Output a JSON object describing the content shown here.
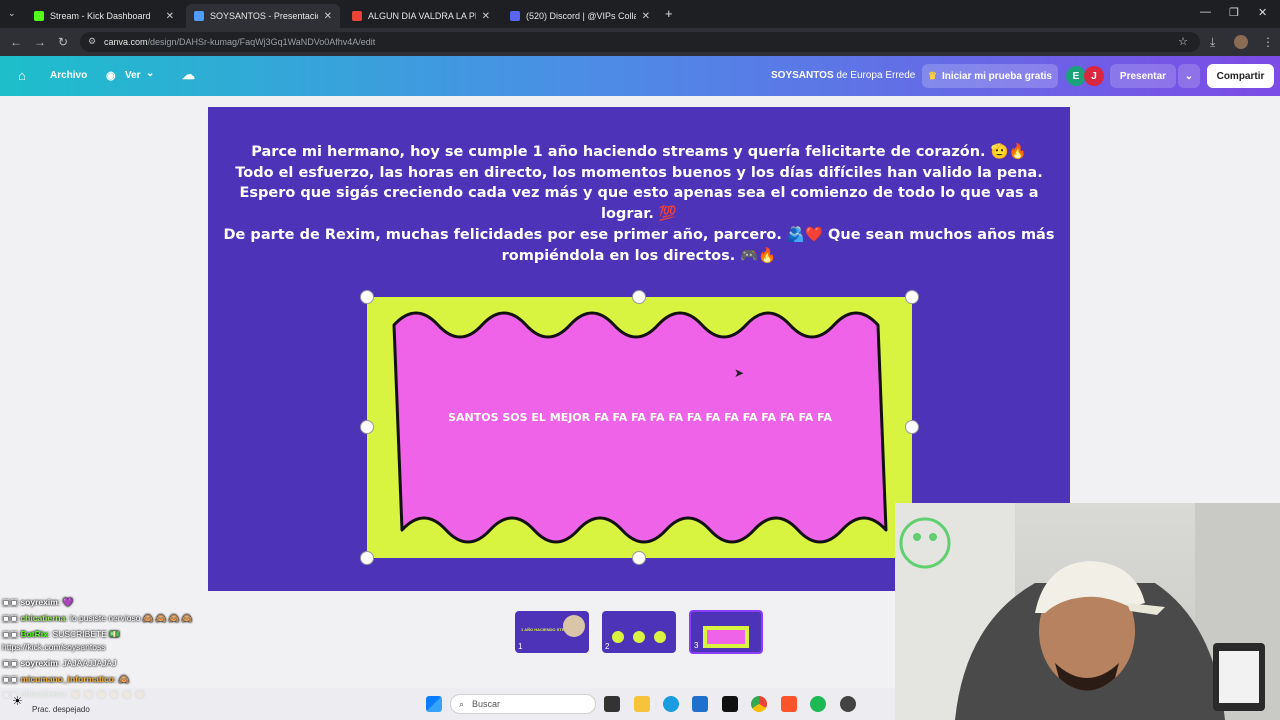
{
  "browser": {
    "tabs": [
      {
        "title": "Stream - Kick Dashboard",
        "active": false,
        "favicon_color": "#53fc18"
      },
      {
        "title": "SOYSANTOS - Presentación",
        "active": true,
        "favicon_color": "#4e9dff"
      },
      {
        "title": "ALGUN DIA VALDRA LA PENA.",
        "active": false,
        "favicon_color": "#ea4335"
      },
      {
        "title": "(520) Discord | @VIPs Collage S",
        "active": false,
        "favicon_color": "#5865f2"
      }
    ],
    "new_tab": "+",
    "url_host": "canva.com",
    "url_path": "/design/DAHSr-kumag/FaqWj3Gq1WaNDVo0Afhv4A/edit"
  },
  "toolbar": {
    "archivo": "Archivo",
    "ver": "Ver",
    "doc_title_bold": "SOYSANTOS",
    "doc_title_rest": " de Europa Errede",
    "trial_button": "Iniciar mi prueba gratis",
    "avatars": [
      {
        "letter": "E",
        "color": "#1aa37a"
      },
      {
        "letter": "J",
        "color": "#d9273f"
      }
    ],
    "present_button": "Presentar",
    "share_button": "Compartir"
  },
  "slide": {
    "message_lines": [
      "Parce mi hermano, hoy se cumple 1 año haciendo streams y quería felicitarte de corazón. 🫡🔥",
      "Todo el esfuerzo, las horas en directo, los momentos buenos y los días difíciles han valido la pena.",
      "Espero que sigás creciendo cada vez más y que esto apenas sea el comienzo de todo lo que vas a lograr. 💯",
      "De parte de Rexim, muchas felicidades por ese primer año, parcero. 🫂❤️ Que sean muchos años más rompiéndola en los directos. 🎮🔥"
    ],
    "frame_text": "SANTOS SOS EL MEJOR FA FA FA FA FA FA FA FA FA FA FA FA FA",
    "colors": {
      "background": "#4c33b8",
      "frame": "#d8f440",
      "card": "#ee63e8"
    }
  },
  "thumbnails": [
    {
      "number": "1",
      "selected": false,
      "caption": "1 AÑO HACIENDO STREAM"
    },
    {
      "number": "2",
      "selected": false
    },
    {
      "number": "3",
      "selected": true
    }
  ],
  "chat": [
    {
      "user": "soyrexim",
      "message": ": 💜",
      "color": "#ffffff"
    },
    {
      "user": "chicatierna",
      "message": ": lo pusiste nervioso 🙈 🙈 🙈 🙈",
      "color": "#9fe86a"
    },
    {
      "user": "BotRix",
      "message": ": SUSCRIBETE 💵",
      "color": "#53fc18"
    },
    {
      "user": "",
      "message": "https://kick.com/soysantoss",
      "color": "#ffffff"
    },
    {
      "user": "soyrexim",
      "message": ": JAJAAJJAJAJ",
      "color": "#ffffff"
    },
    {
      "user": "micumano_informatico",
      "message": ": 🙈",
      "color": "#f3b33d"
    },
    {
      "user": "chicatierna",
      "message": ": 👏 👏 👏 👏 👏 👏",
      "color": "#9fe86a"
    }
  ],
  "taskbar": {
    "weather": "Prac. despejado",
    "search_placeholder": "Buscar"
  }
}
